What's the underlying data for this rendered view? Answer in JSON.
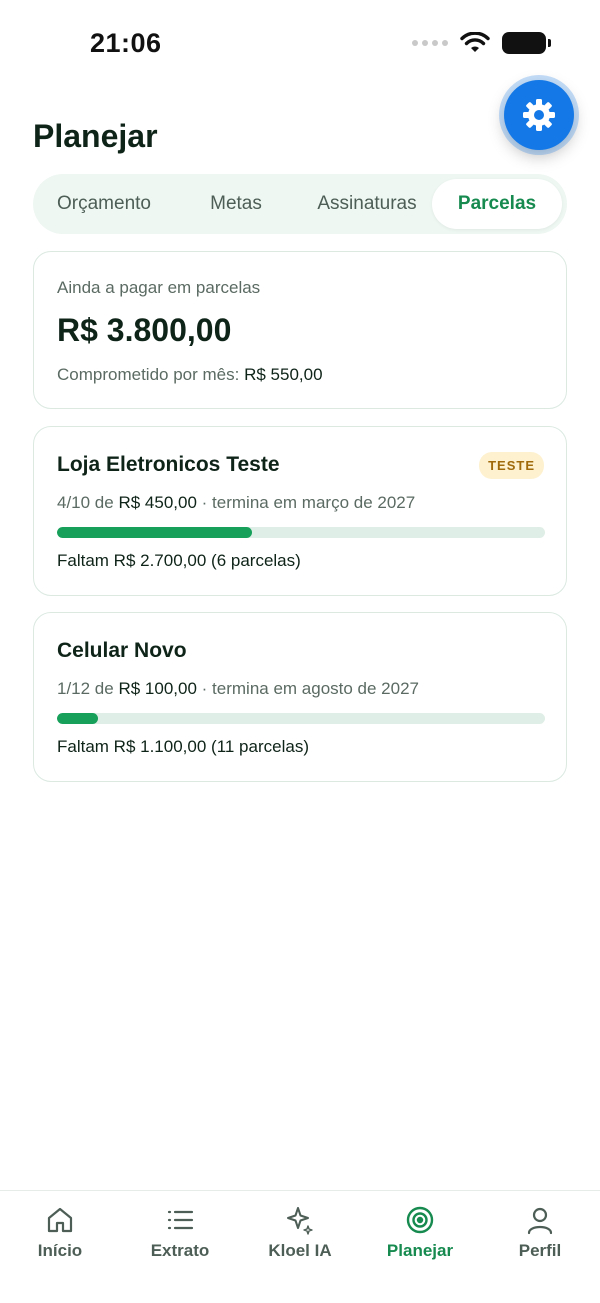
{
  "status_bar": {
    "time": "21:06"
  },
  "header": {
    "title": "Planejar"
  },
  "tabs": [
    {
      "label": "Orçamento",
      "active": false
    },
    {
      "label": "Metas",
      "active": false
    },
    {
      "label": "Assinaturas",
      "active": false
    },
    {
      "label": "Parcelas",
      "active": true
    }
  ],
  "summary": {
    "label": "Ainda a pagar em parcelas",
    "amount": "R$ 3.800,00",
    "monthly_label": "Comprometido por mês:",
    "monthly_value": "R$ 550,00"
  },
  "installments": [
    {
      "name": "Loja Eletronicos Teste",
      "badge": "TESTE",
      "progress_text": "4/10 de",
      "installment_value": "R$ 450,00",
      "end_text": "· termina em março de 2027",
      "progress_fraction": 0.4,
      "remaining": "Faltam R$ 2.700,00 (6 parcelas)"
    },
    {
      "name": "Celular Novo",
      "progress_text": "1/12 de",
      "installment_value": "R$ 100,00",
      "end_text": "· termina em agosto de 2027",
      "progress_fraction": 0.0833,
      "remaining": "Faltam R$ 1.100,00 (11 parcelas)"
    }
  ],
  "bottom_nav": [
    {
      "label": "Início",
      "icon": "home-icon",
      "active": false
    },
    {
      "label": "Extrato",
      "icon": "list-icon",
      "active": false
    },
    {
      "label": "Kloel IA",
      "icon": "sparkle-icon",
      "active": false
    },
    {
      "label": "Planejar",
      "icon": "target-icon",
      "active": true
    },
    {
      "label": "Perfil",
      "icon": "user-icon",
      "active": false
    }
  ],
  "colors": {
    "accent": "#168a4f",
    "progress": "#16a05a",
    "fab": "#1479e6",
    "badge_bg": "#fdf1cf",
    "badge_text": "#a06a0b"
  }
}
